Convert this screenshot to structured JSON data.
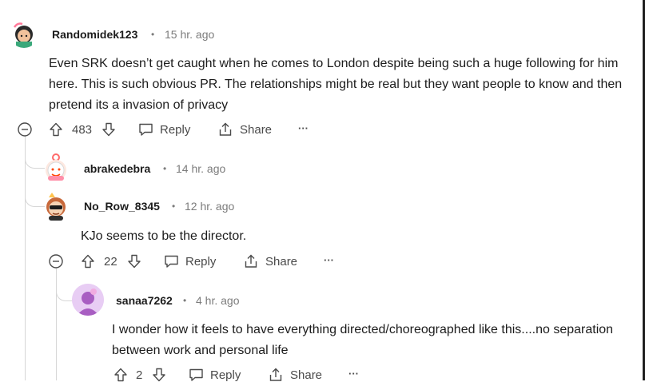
{
  "comments": [
    {
      "username": "Randomidek123",
      "separator": "•",
      "time": "15 hr. ago",
      "body": "Even SRK doesn’t get caught when he comes to London despite being such a huge following for him here. This is such obvious PR. The relationships might be real but they want people to know and then pretend its a invasion of privacy",
      "votes": "483",
      "reply_label": "Reply",
      "share_label": "Share",
      "more_label": "···"
    },
    {
      "username": "abrakedebra",
      "separator": "•",
      "time": "14 hr. ago"
    },
    {
      "username": "No_Row_8345",
      "separator": "•",
      "time": "12 hr. ago",
      "body": "KJo seems to be the director.",
      "votes": "22",
      "reply_label": "Reply",
      "share_label": "Share",
      "more_label": "···"
    },
    {
      "username": "sanaa7262",
      "separator": "•",
      "time": "4 hr. ago",
      "body": "I wonder how it feels to have everything directed/choreographed like this....no separation between work and personal life",
      "votes": "2",
      "reply_label": "Reply",
      "share_label": "Share",
      "more_label": "···"
    }
  ],
  "colors": {
    "thread_line": "#d7d7d7",
    "meta": "#7c7c7c",
    "text": "#1c1c1c"
  },
  "icons": [
    "collapse-icon",
    "upvote-icon",
    "downvote-icon",
    "reply-icon",
    "share-icon",
    "more-icon"
  ]
}
